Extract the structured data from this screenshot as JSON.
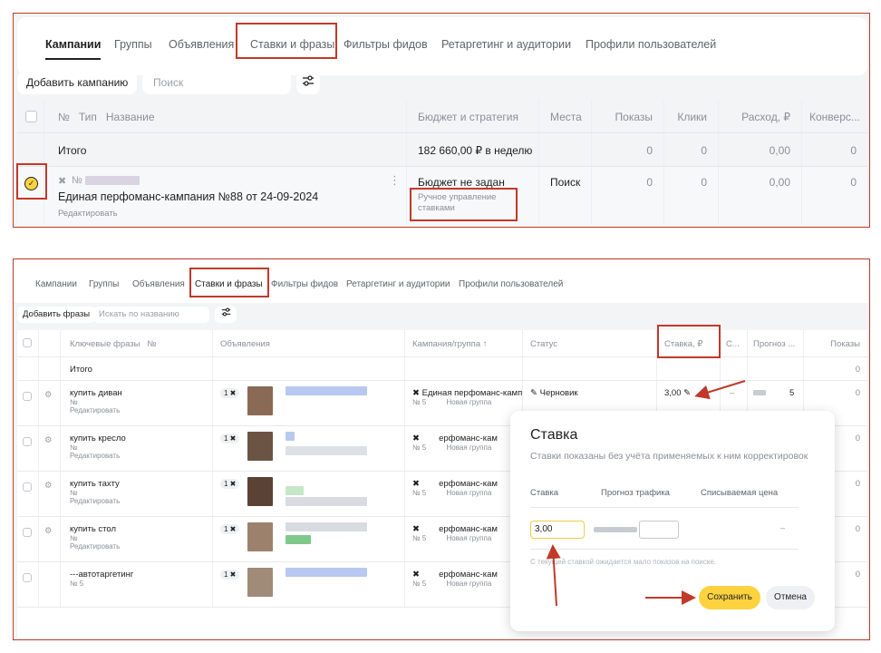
{
  "panel1": {
    "tabs": [
      "Кампании",
      "Группы",
      "Объявления",
      "Ставки и фразы",
      "Фильтры фидов",
      "Ретаргетинг и аудитории",
      "Профили пользователей"
    ],
    "add_button": "Добавить кампанию",
    "search_placeholder": "Поиск",
    "columns": {
      "num_type_name": "№   Тип   Название",
      "budget": "Бюджет и стратегия",
      "places": "Места",
      "impressions": "Показы",
      "clicks": "Клики",
      "cost": "Расход, ₽",
      "conversions": "Конверс..."
    },
    "total_row": {
      "label": "Итого",
      "budget": "182 660,00 ₽ в неделю",
      "impressions": "0",
      "clicks": "0",
      "cost": "0,00",
      "conversions": "0"
    },
    "campaign_row": {
      "number_prefix": "№",
      "name": "Единая перфоманс-кампания №88 от 24-09-2024",
      "edit_link": "Редактировать",
      "budget": "Бюджет не задан",
      "strategy": "Ручное управление ставками",
      "places": "Поиск",
      "impressions": "0",
      "clicks": "0",
      "cost": "0,00",
      "conversions": "0"
    }
  },
  "panel2": {
    "tabs": [
      "Кампании",
      "Группы",
      "Объявления",
      "Ставки и фразы",
      "Фильтры фидов",
      "Ретаргетинг и аудитории",
      "Профили пользователей"
    ],
    "add_button": "Добавить фразы",
    "search_placeholder": "Искать по названию",
    "columns": {
      "keywords": "Ключевые фразы   №",
      "ads": "Объявления",
      "campaign_group": "Кампания/группа ↑",
      "status": "Статус",
      "rate": "Ставка, ₽",
      "c": "С...",
      "forecast": "Прогноз ...",
      "impressions": "Показы"
    },
    "total_label": "Итого",
    "total_impressions": "0",
    "rows": [
      {
        "phrase": "купить диван",
        "num": "№",
        "edit": "Редактировать",
        "ads_count": "1",
        "campaign": "Единая перфоманс-камп",
        "group_prefix": "№ 5",
        "group": "Новая группа",
        "status": "Черновик",
        "rate": "3,00",
        "c": "–",
        "forecast": "5",
        "impressions": "0"
      },
      {
        "phrase": "купить кресло",
        "num": "№",
        "edit": "Редактировать",
        "ads_count": "1",
        "campaign": "ерфоманс-кам",
        "group_prefix": "№ 5",
        "group": "Новая группа",
        "impressions": "0"
      },
      {
        "phrase": "купить тахту",
        "num": "№",
        "edit": "Редактировать",
        "ads_count": "1",
        "campaign": "ерфоманс-кам",
        "group_prefix": "№ 5",
        "group": "Новая группа",
        "impressions": "0"
      },
      {
        "phrase": "купить стол",
        "num": "№",
        "edit": "Редактировать",
        "ads_count": "1",
        "campaign": "ерфоманс-кам",
        "group_prefix": "№ 5",
        "group": "Новая группа",
        "impressions": "0"
      },
      {
        "phrase": "---автотаргетинг",
        "num": "№ 5",
        "edit": "",
        "ads_count": "1",
        "campaign": "ерфоманс-кам",
        "group_prefix": "№ 5",
        "group": "Новая группа",
        "impressions": "0"
      }
    ],
    "popup": {
      "title": "Ставка",
      "subtitle": "Ставки показаны без учёта применяемых к ним корректировок",
      "label_rate": "Ставка",
      "label_forecast": "Прогноз трафика",
      "label_price": "Списываемая цена",
      "rate_value": "3,00",
      "price_value": "–",
      "hint": "С текущей ставкой ожидается мало показов на поиске.",
      "save": "Сохранить",
      "cancel": "Отмена"
    }
  },
  "colors": {
    "highlight": "#c0392b",
    "accent_yellow": "#fcd33f",
    "border_yellow": "#f2c94c"
  }
}
